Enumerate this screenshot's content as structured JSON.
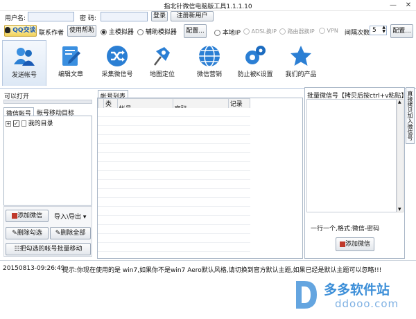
{
  "window": {
    "title": "指北针微信电脑版工具1.1.1.10",
    "min_icon": "minimize-icon",
    "close_icon": "close-icon"
  },
  "login": {
    "username_label": "用户名:",
    "username_value": "",
    "password_label": "密  码:",
    "password_value": "",
    "login_button": "登录",
    "register_button": "注册新用户",
    "qq_button": "QQ交谈",
    "contact_label": "联系作者",
    "help_button": "使用帮助"
  },
  "mode": {
    "main_emulator": "主模拟器",
    "aux_emulator": "辅助模拟器",
    "config_button": "配置...",
    "local_ip": "本地IP",
    "adsl_ip": "ADSL换IP",
    "router_ip": "路由器换IP",
    "vpn": "VPN",
    "interval_label": "间隔次数",
    "interval_value": "5",
    "config_button2": "配置..."
  },
  "toolbar": [
    {
      "label": "发送帐号",
      "icon": "users-icon"
    },
    {
      "label": "编辑文章",
      "icon": "edit-document-icon"
    },
    {
      "label": "采集微信号",
      "icon": "shuffle-icon"
    },
    {
      "label": "地图定位",
      "icon": "map-pin-icon"
    },
    {
      "label": "微信营销",
      "icon": "globe-icon"
    },
    {
      "label": "防止被K设置",
      "icon": "gears-icon"
    },
    {
      "label": "我们的产品",
      "icon": "star-icon"
    }
  ],
  "left": {
    "can_open": "可以打开",
    "tabs": [
      "微信帐号",
      "帐号移动目标"
    ],
    "tree_root": "我的目录",
    "add_wechat": "添加微信",
    "import_export": "导入\\导出",
    "delete_checked": "删除勾选",
    "delete_all": "删除全部",
    "move_checked": "把勾选的帐号批量移动"
  },
  "center": {
    "tab": "帐号列表",
    "columns": [
      "类型",
      "帐号",
      "密码",
      "记录编号"
    ]
  },
  "right": {
    "header": "批量微信号【拷贝后按ctrl+v粘贴】",
    "side_tab": "直接拷贝加入微信号",
    "hint": "一行一个,格式:微信-密码",
    "add_button": "添加微信"
  },
  "status": {
    "timestamp": "20150813-09:26:49",
    "message": "提示:你现在使用的是 win7,如果你不是win7 Aero默认风格,请切换到官方默认主题,如果已经是默认主题可以忽略!!!"
  },
  "watermark": {
    "brand": "多多软件站",
    "url": "ddooo.com"
  },
  "colors": {
    "accent": "#2b7fd4",
    "panel_border": "#aab7c7",
    "watermark": "#3d8fd8"
  }
}
